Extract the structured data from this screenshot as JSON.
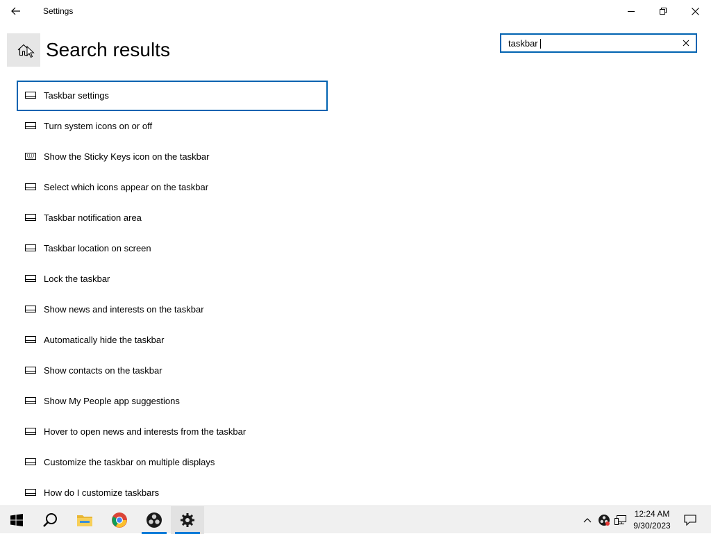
{
  "window": {
    "title": "Settings"
  },
  "header": {
    "page_title": "Search results"
  },
  "search": {
    "value": "taskbar",
    "placeholder": ""
  },
  "results": [
    {
      "label": "Taskbar settings",
      "icon": "taskbar-icon",
      "selected": true
    },
    {
      "label": "Turn system icons on or off",
      "icon": "taskbar-icon"
    },
    {
      "label": "Show the Sticky Keys icon on the taskbar",
      "icon": "keyboard-icon"
    },
    {
      "label": "Select which icons appear on the taskbar",
      "icon": "taskbar-icon"
    },
    {
      "label": "Taskbar notification area",
      "icon": "taskbar-icon"
    },
    {
      "label": "Taskbar location on screen",
      "icon": "taskbar-icon"
    },
    {
      "label": "Lock the taskbar",
      "icon": "taskbar-icon"
    },
    {
      "label": "Show news and interests on the taskbar",
      "icon": "taskbar-icon"
    },
    {
      "label": "Automatically hide the taskbar",
      "icon": "taskbar-icon"
    },
    {
      "label": "Show contacts on the taskbar",
      "icon": "taskbar-icon"
    },
    {
      "label": "Show My People app suggestions",
      "icon": "taskbar-icon"
    },
    {
      "label": "Hover to open news and interests from the taskbar",
      "icon": "taskbar-icon"
    },
    {
      "label": "Customize the taskbar on multiple displays",
      "icon": "taskbar-icon"
    },
    {
      "label": "How do I customize taskbars",
      "icon": "taskbar-icon"
    }
  ],
  "taskbar": {
    "apps": [
      {
        "name": "start-icon"
      },
      {
        "name": "search-icon"
      },
      {
        "name": "file-explorer-icon"
      },
      {
        "name": "chrome-icon"
      },
      {
        "name": "obs-icon"
      },
      {
        "name": "settings-gear-icon"
      }
    ],
    "clock": {
      "time": "12:24 AM",
      "date": "9/30/2023"
    }
  },
  "colors": {
    "accent": "#0063b1",
    "taskbar_indicator": "#0078d7",
    "taskbar_bg": "#f0f0f0"
  }
}
